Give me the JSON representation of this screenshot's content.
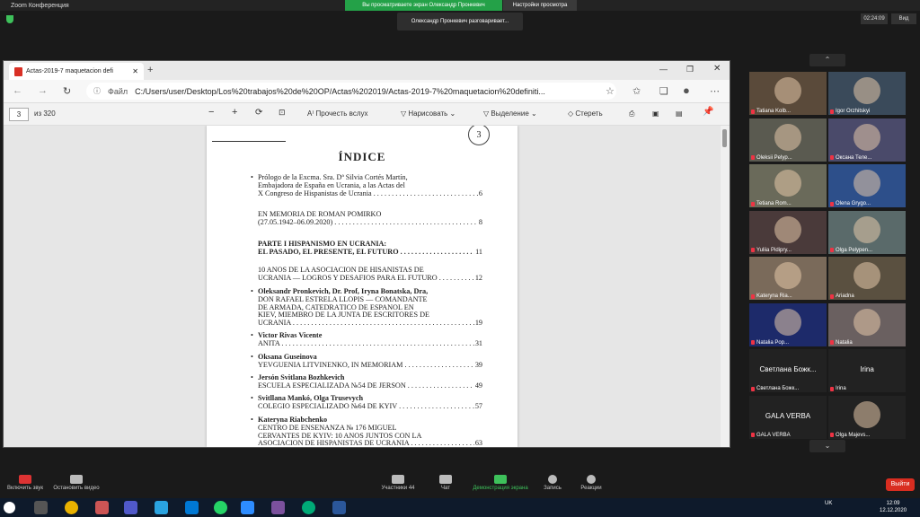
{
  "zoom": {
    "window_title": "Zoom Конференция",
    "share_status": "Вы просматриваете экран Олександр Пронкевич",
    "view_options": "Настройки просмотра",
    "speaker_banner": "Олександр Пронкевич разговаривает...",
    "timer": "02:24:09",
    "view_button": "Вид",
    "toolbar": {
      "audio": "Включить звук",
      "video": "Остановить видео",
      "participants": "Участники",
      "participants_count": "44",
      "chat": "Чат",
      "share": "Демонстрация экрана",
      "record": "Запись",
      "reactions": "Реакции",
      "leave": "Выйти"
    },
    "participants": [
      {
        "name": "Tatiana Kolb..."
      },
      {
        "name": "Igor Orzhitskyi"
      },
      {
        "name": "Oleksii Pelyp..."
      },
      {
        "name": "Оксана Теле..."
      },
      {
        "name": "Tetiana Rom..."
      },
      {
        "name": "Olena Grygo..."
      },
      {
        "name": "Yuliia Pidipry..."
      },
      {
        "name": "Olga Pelypen..."
      },
      {
        "name": "Kateryna Ria..."
      },
      {
        "name": "Ariadna"
      },
      {
        "name": "Natalia Pop..."
      },
      {
        "name": "Natalia"
      },
      {
        "name": "Светлана Божк...",
        "label": "Светлана  Божк..."
      },
      {
        "name": "Irina",
        "label": "Irina"
      },
      {
        "name": "GALA VERBA",
        "label": "GALA VERBA"
      },
      {
        "name": "Olga Majevs..."
      }
    ]
  },
  "browser": {
    "tab_title": "Actas-2019-7 maquetacion defi",
    "address_label": "Файл",
    "url": "C:/Users/user/Desktop/Los%20trabajos%20de%20OP/Actas%202019/Actas-2019-7%20maquetacion%20definiti...",
    "pdf_toolbar": {
      "page_current": "3",
      "page_total": "из 320",
      "read_aloud": "Прочесть вслух",
      "draw": "Нарисовать",
      "highlight": "Выделение",
      "erase": "Стереть"
    }
  },
  "pdf": {
    "page_number": "3",
    "title": "ÍNDICE",
    "entries": [
      {
        "lines": [
          "Prólogo de la Excma. Sra. Dª Silvia Cortés Martín,",
          "Embajadora de España en Ucrania, a las Actas del",
          "X Congreso de Hispanistas de Ucrania"
        ],
        "page": "6"
      },
      {
        "lines": [
          "EN MEMORIA DE ROMÁN POMIRKO",
          "(27.05.1942–06.09.2020)"
        ],
        "page": "8"
      },
      {
        "lines": [
          "PARTE I HISPANISMO EN UCRANIA:",
          "EL PASADO, EL PRESENTE, EL FUTURO"
        ],
        "page": "11"
      },
      {
        "lines": [
          "10 AÑOS DE LA ASOCIACIÓN DE HISANISTAS DE",
          "UCRANIA — LOGROS Y DESAFIOS PARA EL FUTURO"
        ],
        "page": "12"
      },
      {
        "author": "Oleksandr Pronkevich, Dr. Prof, Iryna Bonatska, Dra,",
        "lines": [
          "DON RAFAEL ESTRELA LLOPIS — COMANDANTE",
          "DE ARMADA, CATEDRÁTICO DE ESPAÑOL EN",
          "KIEV, MIEMBRO DE LA JUNTA DE ESCRITORES DE",
          "UCRANIA"
        ],
        "page": "19"
      },
      {
        "author": "Victor Rivas Vicente",
        "lines": [
          "ANITA"
        ],
        "page": "31"
      },
      {
        "author": "Oksana Guseinova",
        "lines": [
          "YEVGUENIA LITVINENKO, IN MEMORIAM"
        ],
        "page": "39"
      },
      {
        "author": "Jersón Svitlana Bozhkevich",
        "lines": [
          "ESCUELA ESPECIALIZADA №54 DE JERSÓN"
        ],
        "page": "49"
      },
      {
        "author": "Svitllana Mankó, Olga Trusevych",
        "lines": [
          "COLEGIO ESPECIALIZADO №64 DE KYIV"
        ],
        "page": "57"
      },
      {
        "author": "Kateryna Riabchenko",
        "lines": [
          "CENTRO DE ENSEÑANZA № 176 MIGUEL",
          "CERVANTES DE KYIV: 10 AÑOS JUNTOS CON LA",
          "ASOCIACIÓN DE HISPANISTAS DE UCRANIA"
        ],
        "page": "63"
      }
    ]
  },
  "taskbar": {
    "lang": "UK",
    "time": "12:09",
    "date": "12.12.2020"
  }
}
